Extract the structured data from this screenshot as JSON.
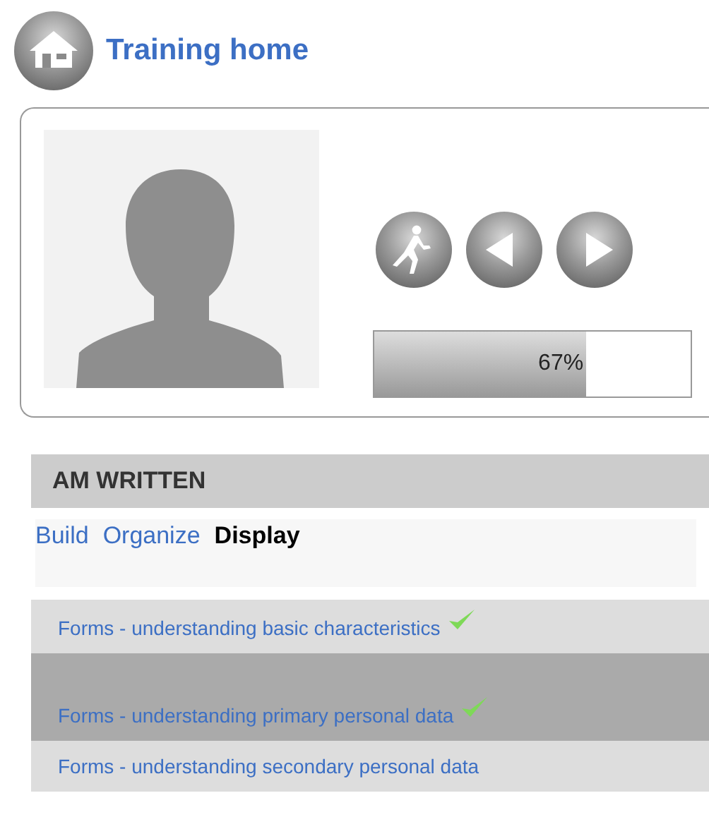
{
  "header": {
    "title": "Training home"
  },
  "player": {
    "buttons": [
      {
        "kind": "run"
      },
      {
        "kind": "previous"
      },
      {
        "kind": "next"
      }
    ],
    "progress": {
      "level": 0.67,
      "reading": "67%"
    }
  },
  "section": {
    "title": "AM WRITTEN"
  },
  "tabs": [
    {
      "label": "Build",
      "selected": false
    },
    {
      "label": "Organize",
      "selected": false
    },
    {
      "label": "Display",
      "selected": true
    }
  ],
  "lessons": [
    {
      "title": "Forms - understanding basic characteristics",
      "completed": true,
      "selected": false
    },
    {
      "title": "Forms - understanding primary personal data",
      "completed": true,
      "selected": true
    },
    {
      "title": "Forms - understanding secondary personal data",
      "completed": false,
      "selected": false
    }
  ]
}
